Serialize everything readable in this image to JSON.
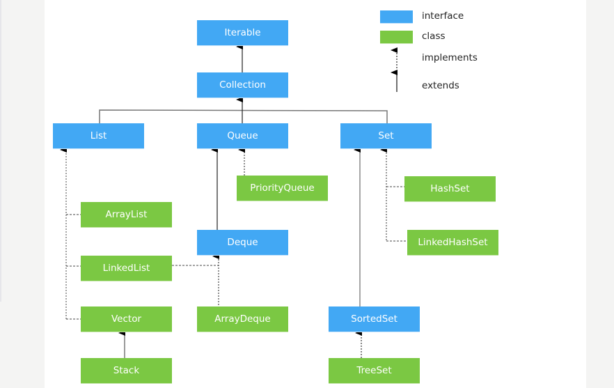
{
  "colors": {
    "interface": "#42a8f4",
    "class": "#7bc843",
    "line": "#333333",
    "background": "#f4f4f3"
  },
  "legend": {
    "interface_label": "interface",
    "class_label": "class",
    "implements_label": "implements",
    "extends_label": "extends"
  },
  "nodes": {
    "iterable": "Iterable",
    "collection": "Collection",
    "list": "List",
    "queue": "Queue",
    "set": "Set",
    "priorityqueue": "PriorityQueue",
    "hashset": "HashSet",
    "arraylist": "ArrayList",
    "deque": "Deque",
    "linkedhashset": "LinkedHashSet",
    "linkedlist": "LinkedList",
    "vector": "Vector",
    "arraydeque": "ArrayDeque",
    "sortedset": "SortedSet",
    "stack": "Stack",
    "treeset": "TreeSet"
  },
  "relations": [
    {
      "from": "Collection",
      "to": "Iterable",
      "type": "extends"
    },
    {
      "from": "List",
      "to": "Collection",
      "type": "extends"
    },
    {
      "from": "Queue",
      "to": "Collection",
      "type": "extends"
    },
    {
      "from": "Set",
      "to": "Collection",
      "type": "extends"
    },
    {
      "from": "PriorityQueue",
      "to": "Queue",
      "type": "implements"
    },
    {
      "from": "Deque",
      "to": "Queue",
      "type": "extends"
    },
    {
      "from": "ArrayDeque",
      "to": "Deque",
      "type": "implements"
    },
    {
      "from": "LinkedList",
      "to": "Deque",
      "type": "implements"
    },
    {
      "from": "ArrayList",
      "to": "List",
      "type": "implements"
    },
    {
      "from": "LinkedList",
      "to": "List",
      "type": "implements"
    },
    {
      "from": "Vector",
      "to": "List",
      "type": "implements"
    },
    {
      "from": "Stack",
      "to": "Vector",
      "type": "extends"
    },
    {
      "from": "HashSet",
      "to": "Set",
      "type": "implements"
    },
    {
      "from": "LinkedHashSet",
      "to": "Set",
      "type": "implements"
    },
    {
      "from": "SortedSet",
      "to": "Set",
      "type": "extends"
    },
    {
      "from": "TreeSet",
      "to": "SortedSet",
      "type": "implements"
    }
  ]
}
